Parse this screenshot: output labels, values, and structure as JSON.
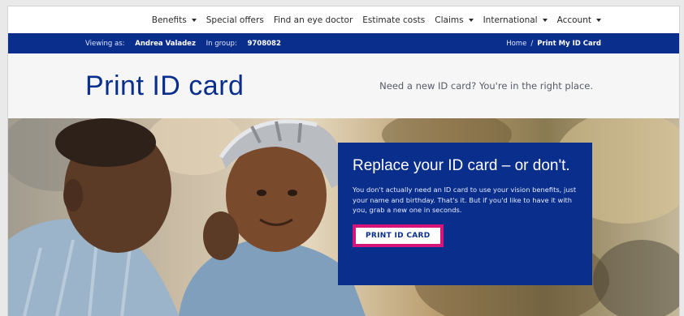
{
  "nav": {
    "items": [
      {
        "label": "Benefits",
        "dropdown": true
      },
      {
        "label": "Special offers",
        "dropdown": false
      },
      {
        "label": "Find an eye doctor",
        "dropdown": false
      },
      {
        "label": "Estimate costs",
        "dropdown": false
      },
      {
        "label": "Claims",
        "dropdown": true
      },
      {
        "label": "International",
        "dropdown": true
      },
      {
        "label": "Account",
        "dropdown": true
      }
    ]
  },
  "userbar": {
    "viewing_prefix": "Viewing as:",
    "viewing_name": "Andrea Valadez",
    "group_prefix": "In group:",
    "group_id": "9708082",
    "breadcrumb_home": "Home",
    "breadcrumb_sep": "/",
    "breadcrumb_current": "Print My ID Card"
  },
  "title": {
    "heading": "Print ID card",
    "tagline": "Need a new ID card?  You're in the right place."
  },
  "hero": {
    "heading": "Replace your ID card – or don't.",
    "body": "You don't actually need an ID card to use your vision benefits, just your name and birthday. That's it. But if you'd like to have it with you, grab a new one in seconds.",
    "button_label": "PRINT ID CARD"
  },
  "colors": {
    "brand_blue": "#0a2e8c",
    "highlight_pink": "#d6147a"
  }
}
